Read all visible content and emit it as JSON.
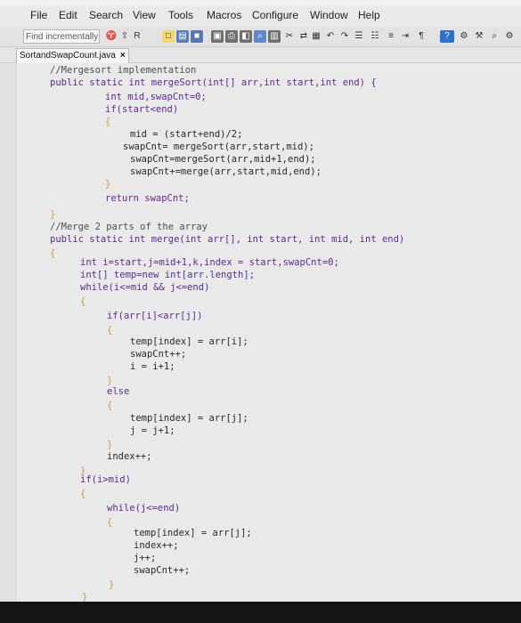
{
  "menu": {
    "items": [
      "File",
      "Edit",
      "Search",
      "View",
      "Tools",
      "Macros",
      "Configure",
      "Window",
      "Help"
    ]
  },
  "toolbar": {
    "find_text": "Find incrementally"
  },
  "tab": {
    "filename": "SortandSwapCount.java",
    "close_label": "×"
  },
  "code_lines": [
    "//Mergesort implementation",
    "public static int mergeSort(int[] arr,int start,int end) {",
    "int mid,swapCnt=0;",
    "if(start<end)",
    "{",
    "mid = (start+end)/2;",
    "swapCnt= mergeSort(arr,start,mid);",
    "swapCnt=mergeSort(arr,mid+1,end);",
    "swapCnt+=merge(arr,start,mid,end);",
    "}",
    "return swapCnt;",
    "}",
    "//Merge 2 parts of the array",
    "public static int merge(int arr[], int start, int mid, int end)",
    "{",
    "int i=start,j=mid+1,k,index = start,swapCnt=0;",
    "int[] temp=new int[arr.length];",
    "while(i<=mid && j<=end)",
    "{",
    "if(arr[i]<arr[j])",
    "{",
    "temp[index] = arr[i];",
    "swapCnt++;",
    "i = i+1;",
    "}",
    "else",
    "{",
    "temp[index] = arr[j];",
    "j = j+1;",
    "}",
    "index++;",
    "}",
    "if(i>mid)",
    "{",
    "while(j<=end)",
    "{",
    "temp[index] = arr[j];",
    "index++;",
    "j++;",
    "swapCnt++;",
    "}",
    "}"
  ]
}
